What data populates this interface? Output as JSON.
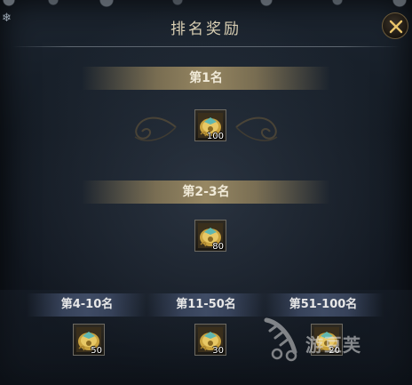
{
  "window": {
    "title": "排名奖励"
  },
  "tiers": [
    {
      "label": "第1名",
      "count": "100"
    },
    {
      "label": "第2-3名",
      "count": "80"
    },
    {
      "label": "第4-10名",
      "count": "50"
    },
    {
      "label": "第11-50名",
      "count": "30"
    },
    {
      "label": "第51-100名",
      "count": "20"
    }
  ],
  "watermark": {
    "text": "游豆芙"
  },
  "icons": {
    "close": "close-x-icon",
    "reward": "golden-chest-icon",
    "decor": "snowflake-icon"
  },
  "colors": {
    "title_text": "#d9cfb3",
    "gold_banner": "#a08c5f",
    "blue_banner": "#3a465f",
    "close_x": "#e8c46a"
  }
}
